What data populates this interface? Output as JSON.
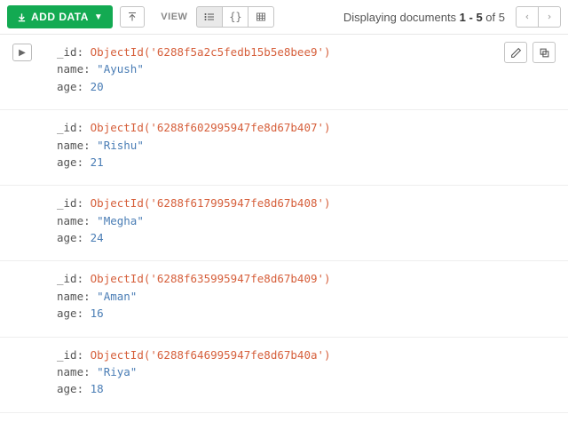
{
  "toolbar": {
    "add_data_label": "ADD DATA",
    "view_label": "VIEW",
    "status_prefix": "Displaying documents ",
    "status_range": "1 - 5",
    "status_mid": " of ",
    "status_total": "5"
  },
  "field_labels": {
    "id": "_id",
    "name": "name",
    "age": "age",
    "colon": ":"
  },
  "docs": [
    {
      "id_wrap": "ObjectId('6288f5a2c5fedb15b5e8bee9')",
      "name": "\"Ayush\"",
      "age": "20"
    },
    {
      "id_wrap": "ObjectId('6288f602995947fe8d67b407')",
      "name": "\"Rishu\"",
      "age": "21"
    },
    {
      "id_wrap": "ObjectId('6288f617995947fe8d67b408')",
      "name": "\"Megha\"",
      "age": "24"
    },
    {
      "id_wrap": "ObjectId('6288f635995947fe8d67b409')",
      "name": "\"Aman\"",
      "age": "16"
    },
    {
      "id_wrap": "ObjectId('6288f646995947fe8d67b40a')",
      "name": "\"Riya\"",
      "age": "18"
    }
  ]
}
